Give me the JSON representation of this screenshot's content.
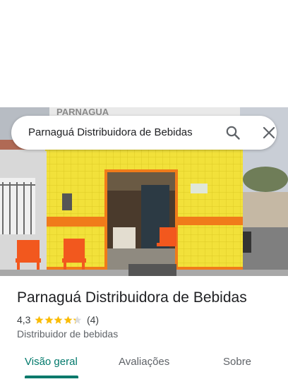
{
  "search": {
    "query": "Parnaguá Distribuidora de Bebidas"
  },
  "place": {
    "name": "Parnaguá Distribuidora de Bebidas",
    "rating": "4,3",
    "rating_value": 4.3,
    "review_count": "(4)",
    "category": "Distribuidor de bebidas"
  },
  "tabs": [
    {
      "label": "Visão geral",
      "active": true
    },
    {
      "label": "Avaliações",
      "active": false
    },
    {
      "label": "Sobre",
      "active": false
    }
  ],
  "icons": {
    "search": "search-icon",
    "close": "close-icon",
    "star": "star-icon"
  },
  "colors": {
    "accent": "#00796b",
    "star": "#fbbc04",
    "wall_tile": "#f2e13a",
    "stripe": "#f07b1a"
  }
}
